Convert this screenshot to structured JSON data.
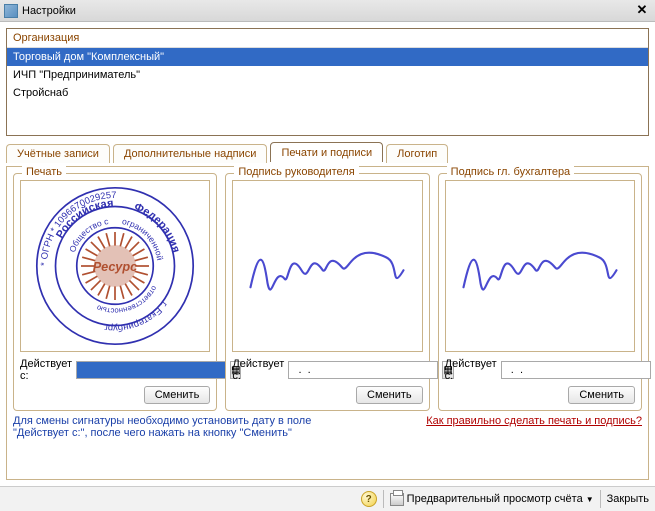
{
  "window": {
    "title": "Настройки",
    "close_glyph": "✕"
  },
  "orgbox": {
    "header": "Организация",
    "rows": [
      "Торговый дом \"Комплексный\"",
      "ИЧП \"Предприниматель\"",
      "Стройснаб"
    ],
    "selected_index": 0
  },
  "tabs": {
    "items": [
      "Учётные записи",
      "Дополнительные надписи",
      "Печати и подписи",
      "Логотип"
    ],
    "active_index": 2
  },
  "panel": {
    "groups": [
      {
        "title": "Печать",
        "date_label": "Действует с:",
        "date_value": "",
        "selected": true,
        "change_label": "Сменить",
        "kind": "stamp"
      },
      {
        "title": "Подпись руководителя",
        "date_label": "Действует с:",
        "date_value": "  .  .",
        "selected": false,
        "change_label": "Сменить",
        "kind": "signature"
      },
      {
        "title": "Подпись гл. бухгалтера",
        "date_label": "Действует с:",
        "date_value": "  .  .",
        "selected": false,
        "change_label": "Сменить",
        "kind": "signature"
      }
    ]
  },
  "stamp": {
    "outer_top": "Российская",
    "outer_right": "Федерация",
    "outer_bottom": "",
    "outer_left": "",
    "outer_side_text": "г. Екатеринбург",
    "outer_nums": "* ОГРН * 1096670029257",
    "inner_top": "Общество с",
    "inner_right": "ограниченной",
    "inner_bottom": "ответственностью",
    "inner_center": "Ресурс"
  },
  "hints": {
    "left": "Для смены сигнатуры необходимо установить дату в поле \"Действует с:\", после чего нажать на кнопку \"Сменить\"",
    "right": "Как правильно сделать печать и подпись?"
  },
  "bottombar": {
    "preview_label": "Предварительный просмотр счёта",
    "close_label": "Закрыть"
  },
  "icons": {
    "calendar_glyph": "▦",
    "chevron_down": "▼",
    "help_glyph": "?"
  }
}
